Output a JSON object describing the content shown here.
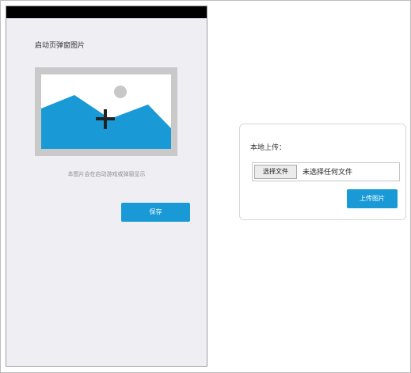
{
  "popup_editor": {
    "title": "启动页弹窗图片",
    "caption": "本图片会在启动游戏或弹窗显示",
    "save_label": "保存",
    "icon": "add-image-icon"
  },
  "upload_card": {
    "label": "本地上传：",
    "choose_file_label": "选择文件",
    "no_file_text": "未选择任何文件",
    "upload_label": "上传图片"
  },
  "colors": {
    "accent": "#199ad6",
    "phone_bg": "#efeef3",
    "top_bar": "#000000",
    "mountain": "#199ad6",
    "sun": "#c8c8c8"
  }
}
